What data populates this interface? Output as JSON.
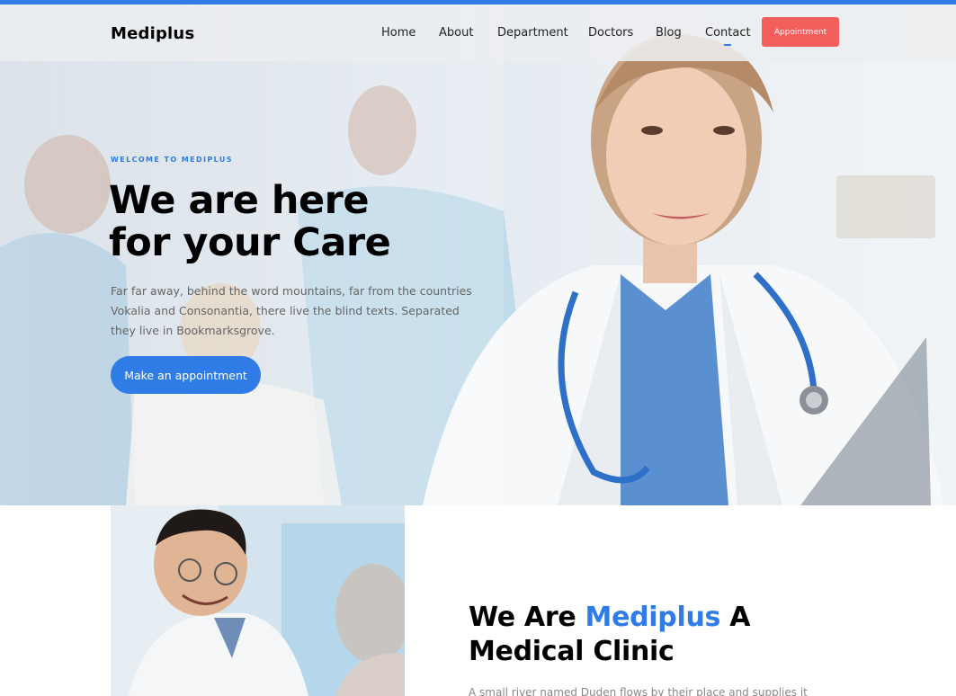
{
  "brand": {
    "name": "Mediplus",
    "accent_color": "#2f7ce6",
    "cta_color": "#f25f5c"
  },
  "nav": {
    "items": [
      {
        "label": "Home"
      },
      {
        "label": "About"
      },
      {
        "label": "Department"
      },
      {
        "label": "Doctors"
      },
      {
        "label": "Blog"
      },
      {
        "label": "Contact",
        "active": true
      }
    ],
    "appointment_label": "Appointment"
  },
  "hero": {
    "eyebrow": "WELCOME TO MEDIPLUS",
    "title_line1": "We are here",
    "title_line2": "for your Care",
    "description": "Far far away, behind the word mountains, far from the countries Vokalia and Consonantia, there live the blind texts. Separated they live in Bookmarksgrove.",
    "cta_label": "Make an appointment"
  },
  "about": {
    "title_part1": "We Are ",
    "title_accent": "Mediplus",
    "title_part2": " A",
    "title_line2": "Medical Clinic",
    "description": "A small river named Duden flows by their place and supplies it"
  }
}
